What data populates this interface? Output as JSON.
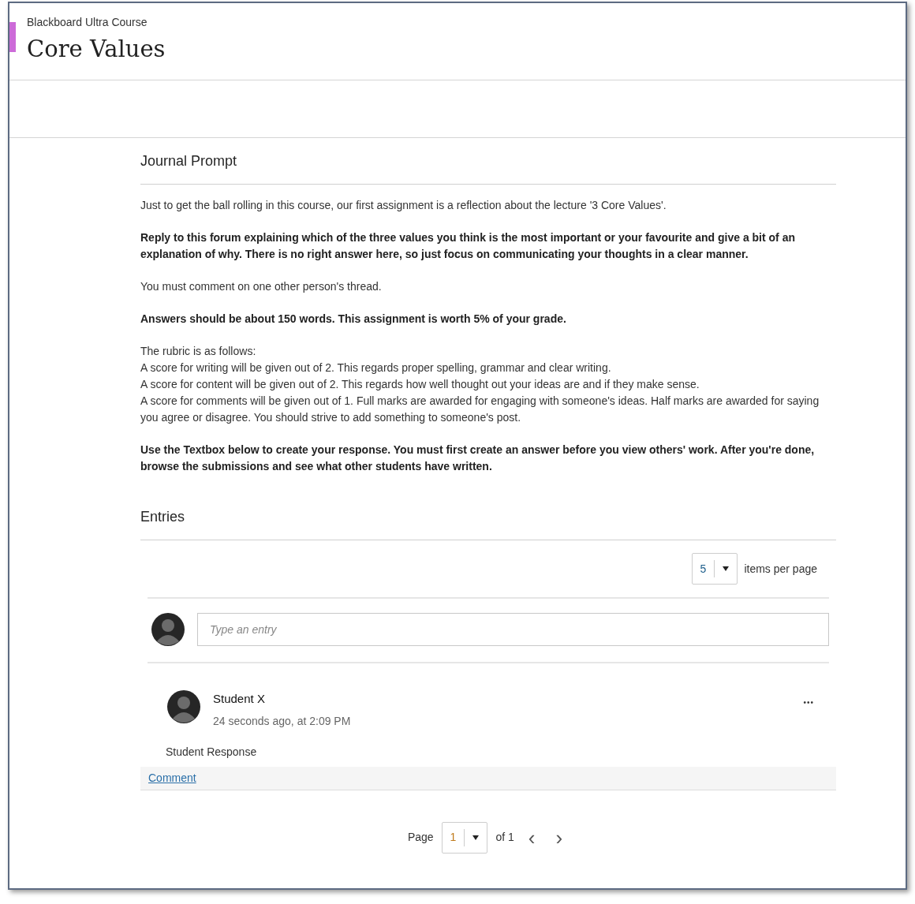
{
  "header": {
    "course": "Blackboard Ultra Course",
    "title": "Core Values"
  },
  "prompt": {
    "heading": "Journal Prompt",
    "paragraphs": [
      {
        "bold": false,
        "lines": [
          "Just to get the ball rolling in this course, our first assignment is a reflection about the lecture '3 Core Values'."
        ]
      },
      {
        "bold": true,
        "lines": [
          "Reply to this forum explaining which of the three values you think is the most important or your favourite and give a bit of an explanation of why. There is no right answer here, so just focus on communicating your thoughts in a clear manner."
        ]
      },
      {
        "bold": false,
        "lines": [
          "You must comment on one other person's thread."
        ]
      },
      {
        "bold": true,
        "lines": [
          "Answers should be about 150 words. This assignment is worth 5% of your grade."
        ]
      },
      {
        "bold": false,
        "lines": [
          "The rubric is as follows:",
          "A score for writing will be given out of 2. This regards proper spelling, grammar and clear writing.",
          "A score for content will be given out of 2. This regards how well thought out your ideas are and if they make sense.",
          "A score for comments will be given out of 1. Full marks are awarded for engaging with someone's ideas. Half marks are awarded for saying you agree or disagree. You should strive to add something to someone's post."
        ]
      },
      {
        "bold": true,
        "lines": [
          "Use the Textbox below to create your response. You must first create an answer before you view others' work. After you're done, browse the submissions and see what other students have written."
        ]
      }
    ]
  },
  "entries": {
    "heading": "Entries",
    "per_page": {
      "value": "5",
      "label": "items per page"
    },
    "new_entry": {
      "placeholder": "Type an entry"
    },
    "posts": [
      {
        "author": "Student X",
        "time": "24 seconds ago, at 2:09 PM",
        "body": "Student Response",
        "more": "•••",
        "comment_link": "Comment"
      }
    ],
    "pager": {
      "label": "Page",
      "value": "1",
      "of": "of 1",
      "prev": "‹",
      "next": "›"
    }
  }
}
